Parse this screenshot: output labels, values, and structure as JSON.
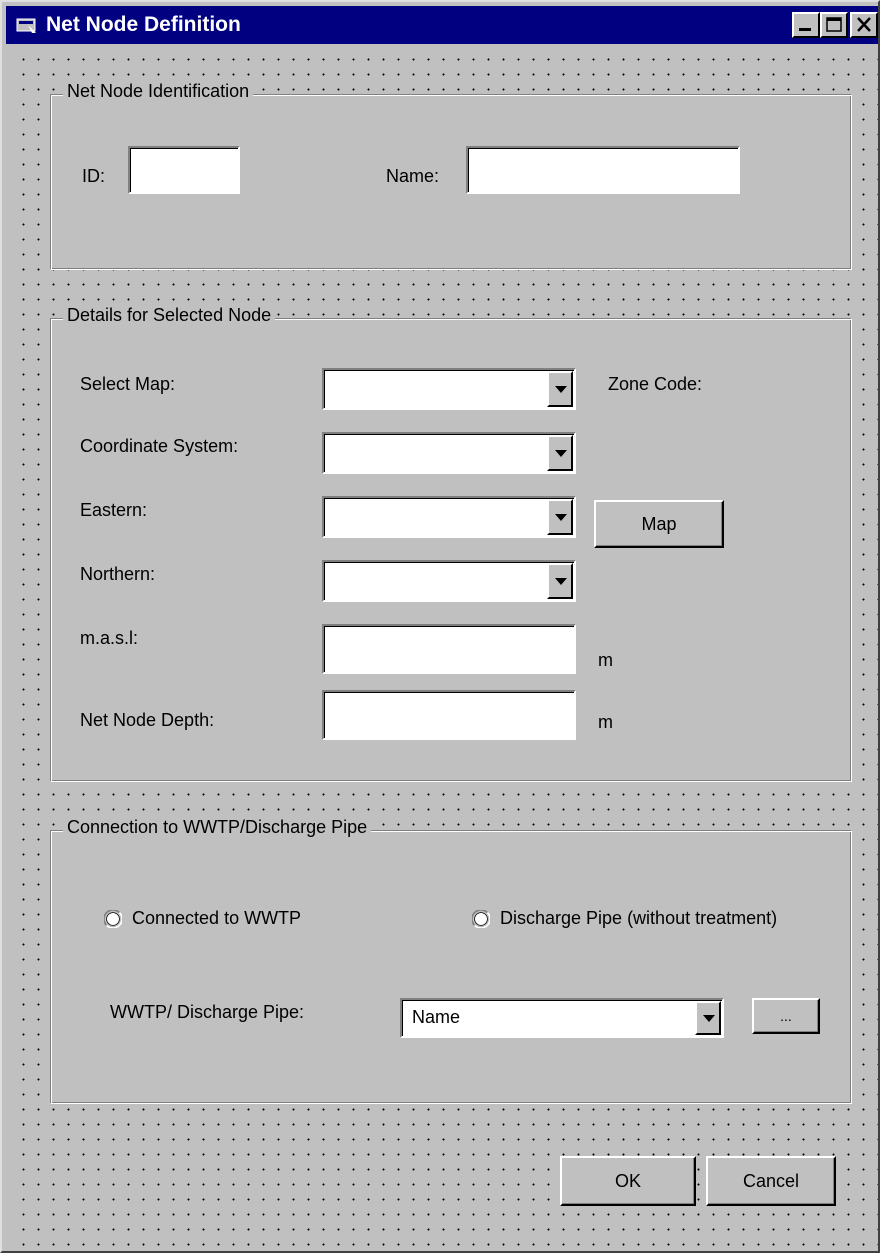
{
  "window": {
    "title": "Net Node Definition"
  },
  "identification": {
    "frame_title": "Net Node Identification",
    "id_label": "ID:",
    "id_value": "",
    "name_label": "Name:",
    "name_value": ""
  },
  "details": {
    "frame_title": "Details for Selected Node",
    "select_map_label": "Select Map:",
    "select_map_value": "",
    "zone_code_label": "Zone Code:",
    "coordinate_system_label": "Coordinate System:",
    "coordinate_system_value": "",
    "eastern_label": "Eastern:",
    "eastern_value": "",
    "map_button": "Map",
    "northern_label": "Northern:",
    "northern_value": "",
    "masl_label": "m.a.s.l:",
    "masl_value": "",
    "masl_unit": "m",
    "depth_label": "Net Node Depth:",
    "depth_value": "",
    "depth_unit": "m"
  },
  "connection": {
    "frame_title": "Connection to WWTP/Discharge Pipe",
    "radio_wwtp": "Connected to WWTP",
    "radio_discharge": "Discharge Pipe (without treatment)",
    "pipe_label": "WWTP/ Discharge Pipe:",
    "pipe_value": "Name",
    "browse_button": "..."
  },
  "footer": {
    "ok_button": "OK",
    "cancel_button": "Cancel"
  },
  "colors": {
    "titlebar": "#000080",
    "face": "#c0c0c0"
  }
}
